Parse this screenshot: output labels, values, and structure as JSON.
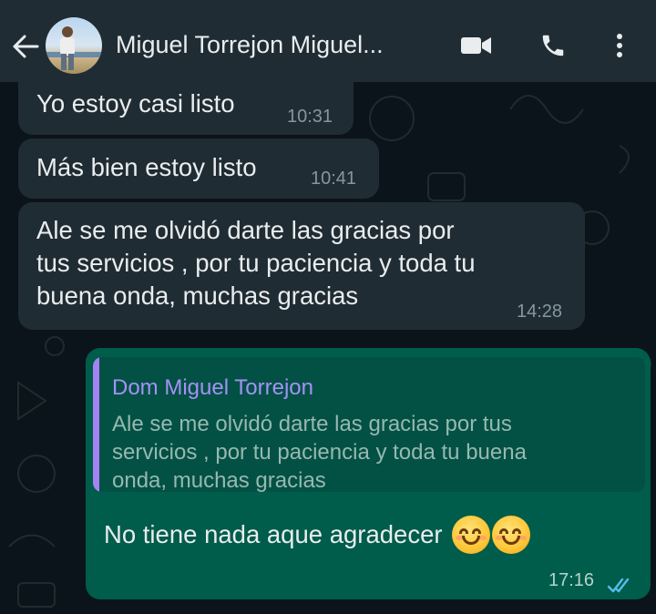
{
  "header": {
    "contact_name": "Miguel Torrejon Miguel...",
    "icons": [
      "back-arrow-icon",
      "video-call-icon",
      "phone-icon",
      "more-options-icon"
    ]
  },
  "messages": [
    {
      "direction": "incoming",
      "text": "Yo estoy casi listo",
      "time": "10:31"
    },
    {
      "direction": "incoming",
      "text": "Más bien estoy listo",
      "time": "10:41"
    },
    {
      "direction": "incoming",
      "lines": [
        "Ale se me olvidó darte las gracias por",
        "tus servicios , por tu paciencia y toda tu",
        "buena onda, muchas gracias"
      ],
      "time": "14:28"
    },
    {
      "direction": "outgoing",
      "reply_to": {
        "author": "Dom Miguel Torrejon",
        "lines": [
          "Ale se me olvidó darte las gracias por tus",
          "servicios , por tu paciencia y toda tu buena",
          "onda, muchas gracias"
        ]
      },
      "text": "No tiene nada aque agradecer",
      "emoji": [
        "smiling-face-icon",
        "smiling-face-icon"
      ],
      "time": "17:16",
      "status": "read"
    }
  ],
  "colors": {
    "background": "#0b141a",
    "header": "#202c33",
    "incoming_bubble": "#202c33",
    "outgoing_bubble": "#005c4b",
    "quote_accent": "#a583f2",
    "read_ticks": "#53bdeb"
  }
}
